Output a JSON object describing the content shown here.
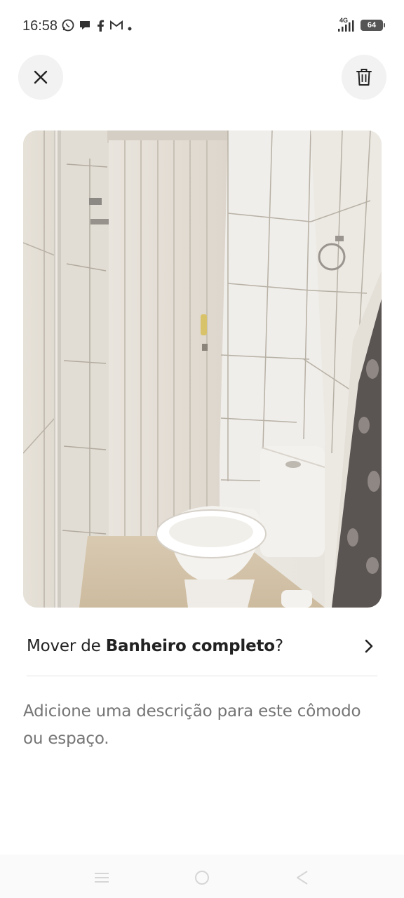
{
  "status_bar": {
    "time": "16:58",
    "network": "4G",
    "battery": "64",
    "notification_icons": [
      "whatsapp-icon",
      "chat-bubble-icon",
      "facebook-icon",
      "gmail-icon",
      "dot-icon"
    ]
  },
  "toolbar": {
    "close_icon": "close-icon",
    "delete_icon": "trash-icon"
  },
  "photo": {
    "subject": "bathroom-photo"
  },
  "move_row": {
    "prefix": "Mover de ",
    "room": "Banheiro completo",
    "suffix": "?",
    "chevron_icon": "chevron-right-icon"
  },
  "description": {
    "placeholder": "Adicione uma descrição para este cômodo ou espaço."
  },
  "nav_bar": {
    "icons": [
      "menu-icon",
      "home-icon",
      "back-icon"
    ]
  },
  "colors": {
    "button_bg": "#f2f2f2",
    "text_primary": "#222222",
    "text_secondary": "#6b6b6b",
    "divider": "#e2e2e2"
  }
}
